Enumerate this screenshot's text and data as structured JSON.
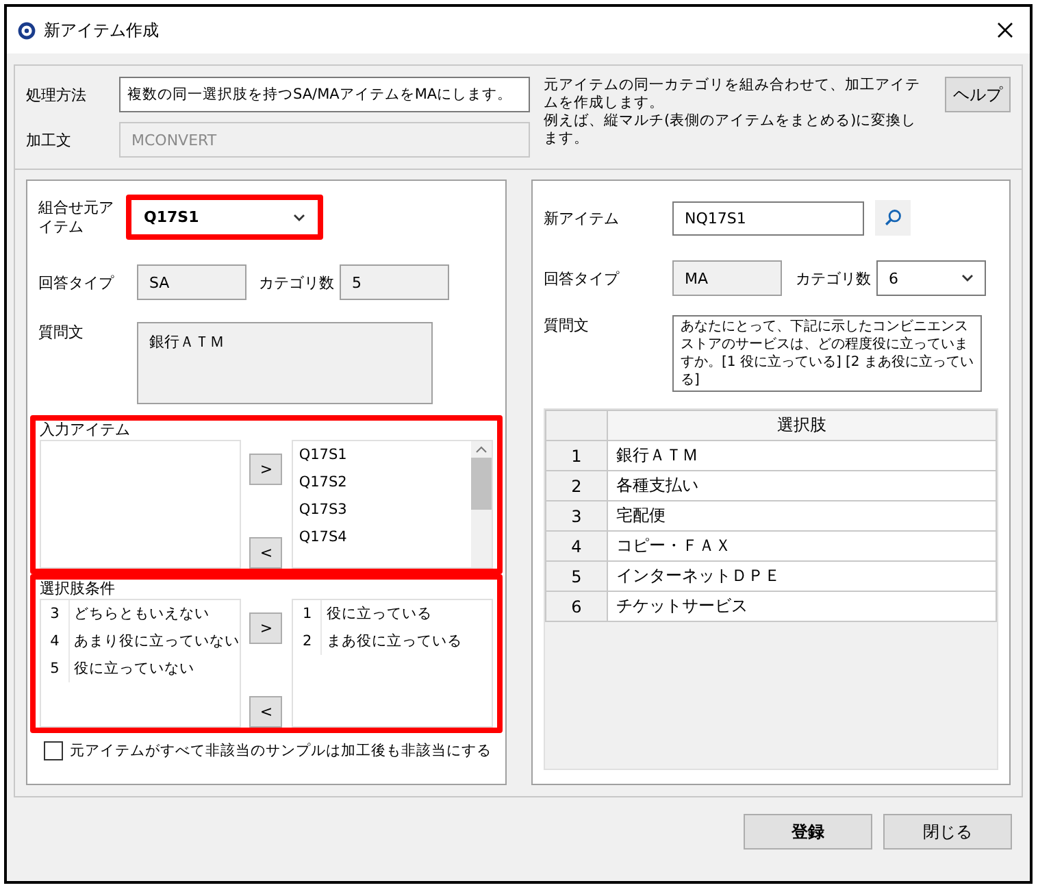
{
  "window": {
    "title": "新アイテム作成"
  },
  "method": {
    "label": "処理方法",
    "value": "複数の同一選択肢を持つSA/MAアイテムをMAにします。"
  },
  "statement": {
    "label": "加工文",
    "value": "MCONVERT",
    "disabled": true
  },
  "description": [
    "元アイテムの同一カテゴリを組み合わせて、加工アイテムを作成します。",
    "例えば、縦マルチ(表側のアイテムをまとめる)に変換します。"
  ],
  "help_button": "ヘルプ",
  "source": {
    "label": "組合せ元アイテム",
    "value": "Q17S1",
    "highlighted": true,
    "answer_type_label": "回答タイプ",
    "answer_type": "SA",
    "category_count_label": "カテゴリ数",
    "category_count": "5",
    "question_label": "質問文",
    "question": "銀行ＡＴＭ"
  },
  "input_items": {
    "label": "入力アイテム",
    "highlighted": true,
    "add_button": ">",
    "remove_button": "<",
    "chosen": [
      "Q17S1",
      "Q17S2",
      "Q17S3",
      "Q17S4"
    ]
  },
  "choice_conditions": {
    "label": "選択肢条件",
    "highlighted": true,
    "add_button": ">",
    "remove_button": "<",
    "available": [
      {
        "code": "3",
        "text": "どちらともいえない"
      },
      {
        "code": "4",
        "text": "あまり役に立っていない"
      },
      {
        "code": "5",
        "text": "役に立っていない"
      }
    ],
    "chosen": [
      {
        "code": "1",
        "text": "役に立っている"
      },
      {
        "code": "2",
        "text": "まあ役に立っている"
      }
    ]
  },
  "missing_option": {
    "label": "元アイテムがすべて非該当のサンプルは加工後も非該当にする",
    "checked": false
  },
  "new_item": {
    "label": "新アイテム",
    "value": "NQ17S1",
    "answer_type_label": "回答タイプ",
    "answer_type": "MA",
    "category_count_label": "カテゴリ数",
    "category_count": "6",
    "question_label": "質問文",
    "question": "あなたにとって、下記に示したコンビニエンスストアのサービスは、どの程度役に立っていますか。[1 役に立っている] [2 まあ役に立っている]"
  },
  "choices_table": {
    "header": "選択肢",
    "rows": [
      {
        "no": "1",
        "text": "銀行ＡＴＭ"
      },
      {
        "no": "2",
        "text": "各種支払い"
      },
      {
        "no": "3",
        "text": "宅配便"
      },
      {
        "no": "4",
        "text": "コピー・ＦＡＸ"
      },
      {
        "no": "5",
        "text": "インターネットＤＰＥ"
      },
      {
        "no": "6",
        "text": "チケットサービス"
      }
    ]
  },
  "buttons": [
    {
      "label": "登録",
      "kind": "primary"
    },
    {
      "label": "閉じる",
      "kind": "normal"
    }
  ]
}
